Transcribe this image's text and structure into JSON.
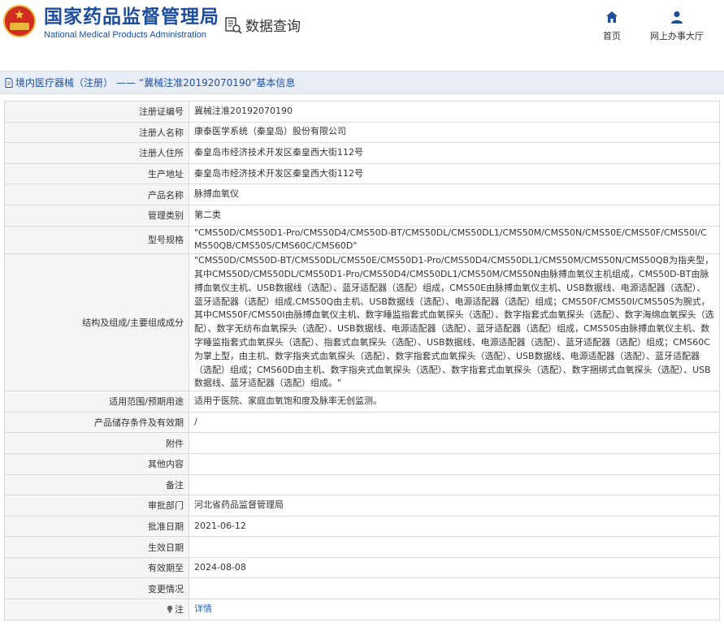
{
  "header": {
    "logo_cn": "国家药品监督管理局",
    "logo_en": "National Medical Products Administration",
    "search_label": "数据查询",
    "nav_home": "首页",
    "nav_online": "网上办事大厅"
  },
  "breadcrumb": {
    "category": "境内医疗器械（注册）",
    "separator": "——",
    "title": "“冀械注准20192070190”基本信息"
  },
  "rows": [
    {
      "label": "注册证编号",
      "value": "冀械注准20192070190"
    },
    {
      "label": "注册人名称",
      "value": "康泰医学系统（秦皇岛）股份有限公司"
    },
    {
      "label": "注册人住所",
      "value": "秦皇岛市经济技术开发区秦皇西大街112号"
    },
    {
      "label": "生产地址",
      "value": "秦皇岛市经济技术开发区秦皇西大街112号"
    },
    {
      "label": "产品名称",
      "value": "脉搏血氧仪"
    },
    {
      "label": "管理类别",
      "value": "第二类"
    },
    {
      "label": "型号规格",
      "value": "\"CMS50D/CMS50D1-Pro/CMS50D4/CMS50D-BT/CMS50DL/CMS50DL1/CMS50M/CMS50N/CMS50E/CMS50F/CMS50I/CMS50QB/CMS50S/CMS60C/CMS60D\""
    },
    {
      "label": "结构及组成/主要组成成分",
      "value": "\"CMS50D/CMS50D-BT/CMS50DL/CMS50E/CMS50D1-Pro/CMS50D4/CMS50DL1/CMS50M/CMS50N/CMS50QB为指夹型，其中CMS50D/CMS50DL/CMS50D1-Pro/CMS50D4/CMS50DL1/CMS50M/CMS50N由脉搏血氧仪主机组成，CMS50D-BT由脉搏血氧仪主机、USB数据线（选配）、蓝牙适配器（选配）组成，CMS50E由脉搏血氧仪主机、USB数据线、电源适配器（选配）、蓝牙适配器（选配）组成,CMS50Q由主机、USB数据线（选配）、电源适配器（选配）组成；CMS50F/CMS50I/CMS50S为腕式，其中CMS50F/CMS50I由脉搏血氧仪主机、数字睡监指套式血氧探头（选配）、数字指套式血氧探头（选配）、数字海绵血氧探头（选配）、数字无纺布血氧探头（选配）、USB数据线、电源适配器（选配）、蓝牙适配器（选配）组成，CMS50S由脉搏血氧仪主机、数字睡监指套式血氧探头（选配）、指套式血氧探头（选配）、USB数据线、电源适配器（选配）、蓝牙适配器（选配）组成；CMS60C为掌上型，由主机、数字指夹式血氧探头（选配）、数字指套式血氧探头（选配）、USB数据线、电源适配器（选配）、蓝牙适配器（选配）组成；CMS60D由主机、数字指夹式血氧探头（选配）、数字指套式血氧探头（选配）、数字捆绑式血氧探头（选配）、USB数据线、蓝牙适配器（选配）组成。\""
    },
    {
      "label": "适用范围/预期用途",
      "value": "适用于医院、家庭血氧饱和度及脉率无创监测。"
    },
    {
      "label": "产品储存条件及有效期",
      "value": "/"
    },
    {
      "label": "附件",
      "value": ""
    },
    {
      "label": "其他内容",
      "value": ""
    },
    {
      "label": "备注",
      "value": ""
    },
    {
      "label": "审批部门",
      "value": "河北省药品监督管理局"
    },
    {
      "label": "批准日期",
      "value": "2021-06-12"
    },
    {
      "label": "生效日期",
      "value": ""
    },
    {
      "label": "有效期至",
      "value": "2024-08-08"
    },
    {
      "label": "变更情况",
      "value": ""
    }
  ],
  "note": {
    "label": "注",
    "link": "详情"
  },
  "colors": {
    "brand_blue": "#1d4e9e",
    "crumb_bg": "#e8edf6",
    "label_bg": "#f5f5f5",
    "link": "#2b62b6"
  }
}
